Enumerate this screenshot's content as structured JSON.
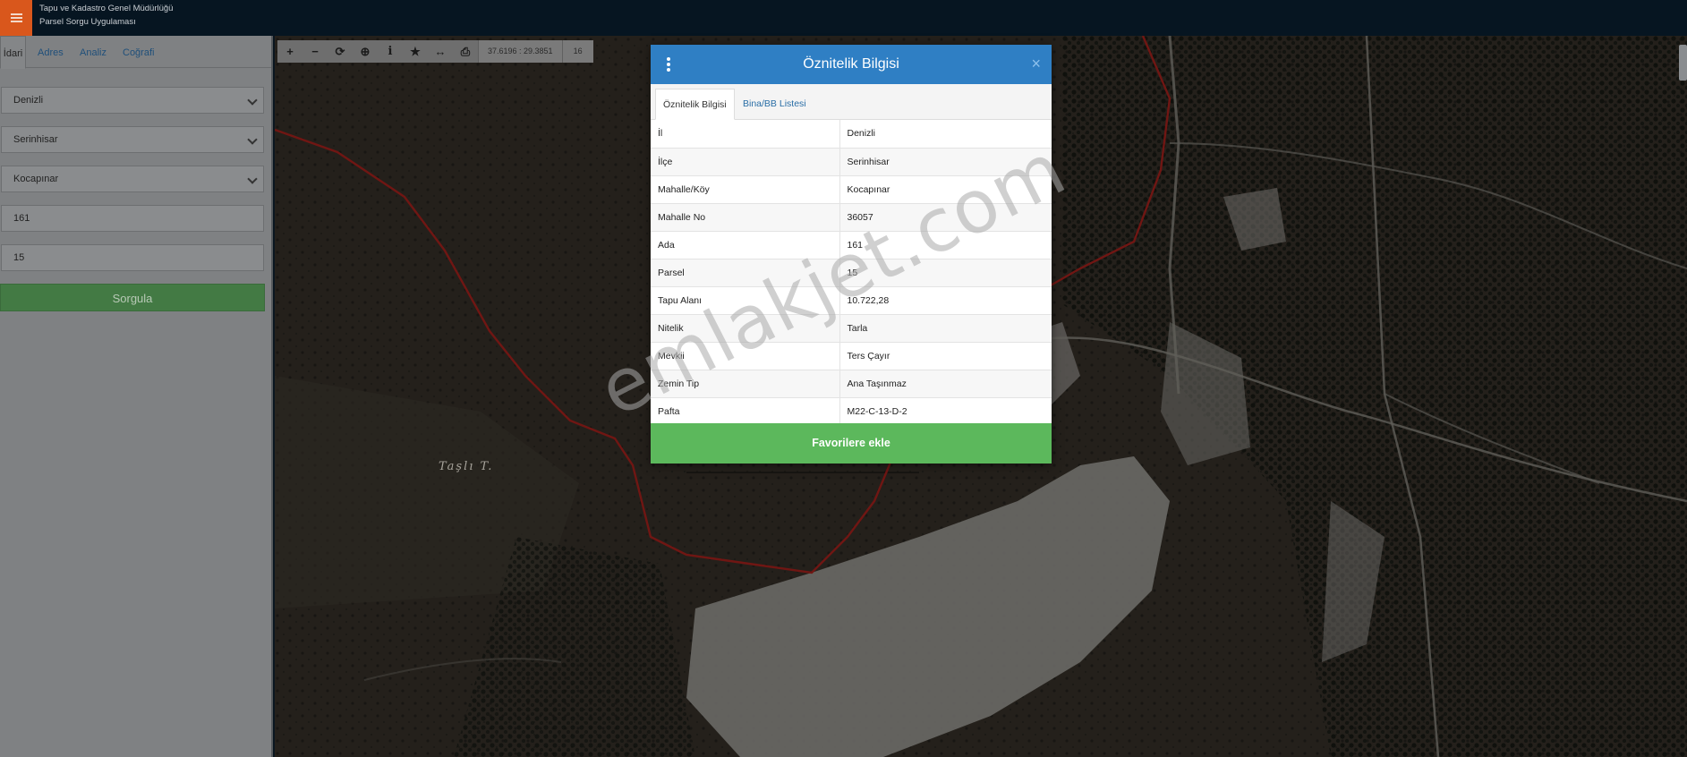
{
  "header": {
    "org_name": "Tapu ve Kadastro Genel Müdürlüğü",
    "app_name": "Parsel Sorgu Uygulaması"
  },
  "sidebar": {
    "tabs": [
      {
        "label": "İdari",
        "active": true
      },
      {
        "label": "Adres",
        "active": false
      },
      {
        "label": "Analiz",
        "active": false
      },
      {
        "label": "Coğrafi",
        "active": false
      }
    ],
    "il_select": "Denizli",
    "ilce_select": "Serinhisar",
    "mahalle_select": "Kocapınar",
    "ada_input": "161",
    "parsel_input": "15",
    "query_button": "Sorgula"
  },
  "map": {
    "coordinates": "37.6196 : 29.3851",
    "zoom_level": "16",
    "place_label": "Taşlı T.",
    "tools": [
      "plus-icon",
      "minus-icon",
      "refresh-icon",
      "locate-icon",
      "info-icon",
      "star-icon",
      "measure-icon",
      "print-icon"
    ]
  },
  "modal": {
    "title": "Öznitelik Bilgisi",
    "close_label": "×",
    "tabs": [
      "Öznitelik Bilgisi",
      "Bina/BB Listesi"
    ],
    "rows": [
      {
        "key": "İl",
        "value": "Denizli"
      },
      {
        "key": "İlçe",
        "value": "Serinhisar"
      },
      {
        "key": "Mahalle/Köy",
        "value": "Kocapınar"
      },
      {
        "key": "Mahalle No",
        "value": "36057"
      },
      {
        "key": "Ada",
        "value": "161"
      },
      {
        "key": "Parsel",
        "value": "15"
      },
      {
        "key": "Tapu Alanı",
        "value": "10.722,28"
      },
      {
        "key": "Nitelik",
        "value": "Tarla"
      },
      {
        "key": "Mevkii",
        "value": "Ters Çayır"
      },
      {
        "key": "Zemin Tip",
        "value": "Ana Taşınmaz"
      },
      {
        "key": "Pafta",
        "value": "M22-C-13-D-2"
      }
    ],
    "favorite_button": "Favorilere ekle"
  },
  "watermark": "emlakjet.com",
  "colors": {
    "header_bg": "#061521",
    "menu_button": "#d9571c",
    "modal_header": "#2f7fc4",
    "favorite_button": "#5cb85c",
    "query_button": "#437a44",
    "parcel_border": "#c62828"
  }
}
